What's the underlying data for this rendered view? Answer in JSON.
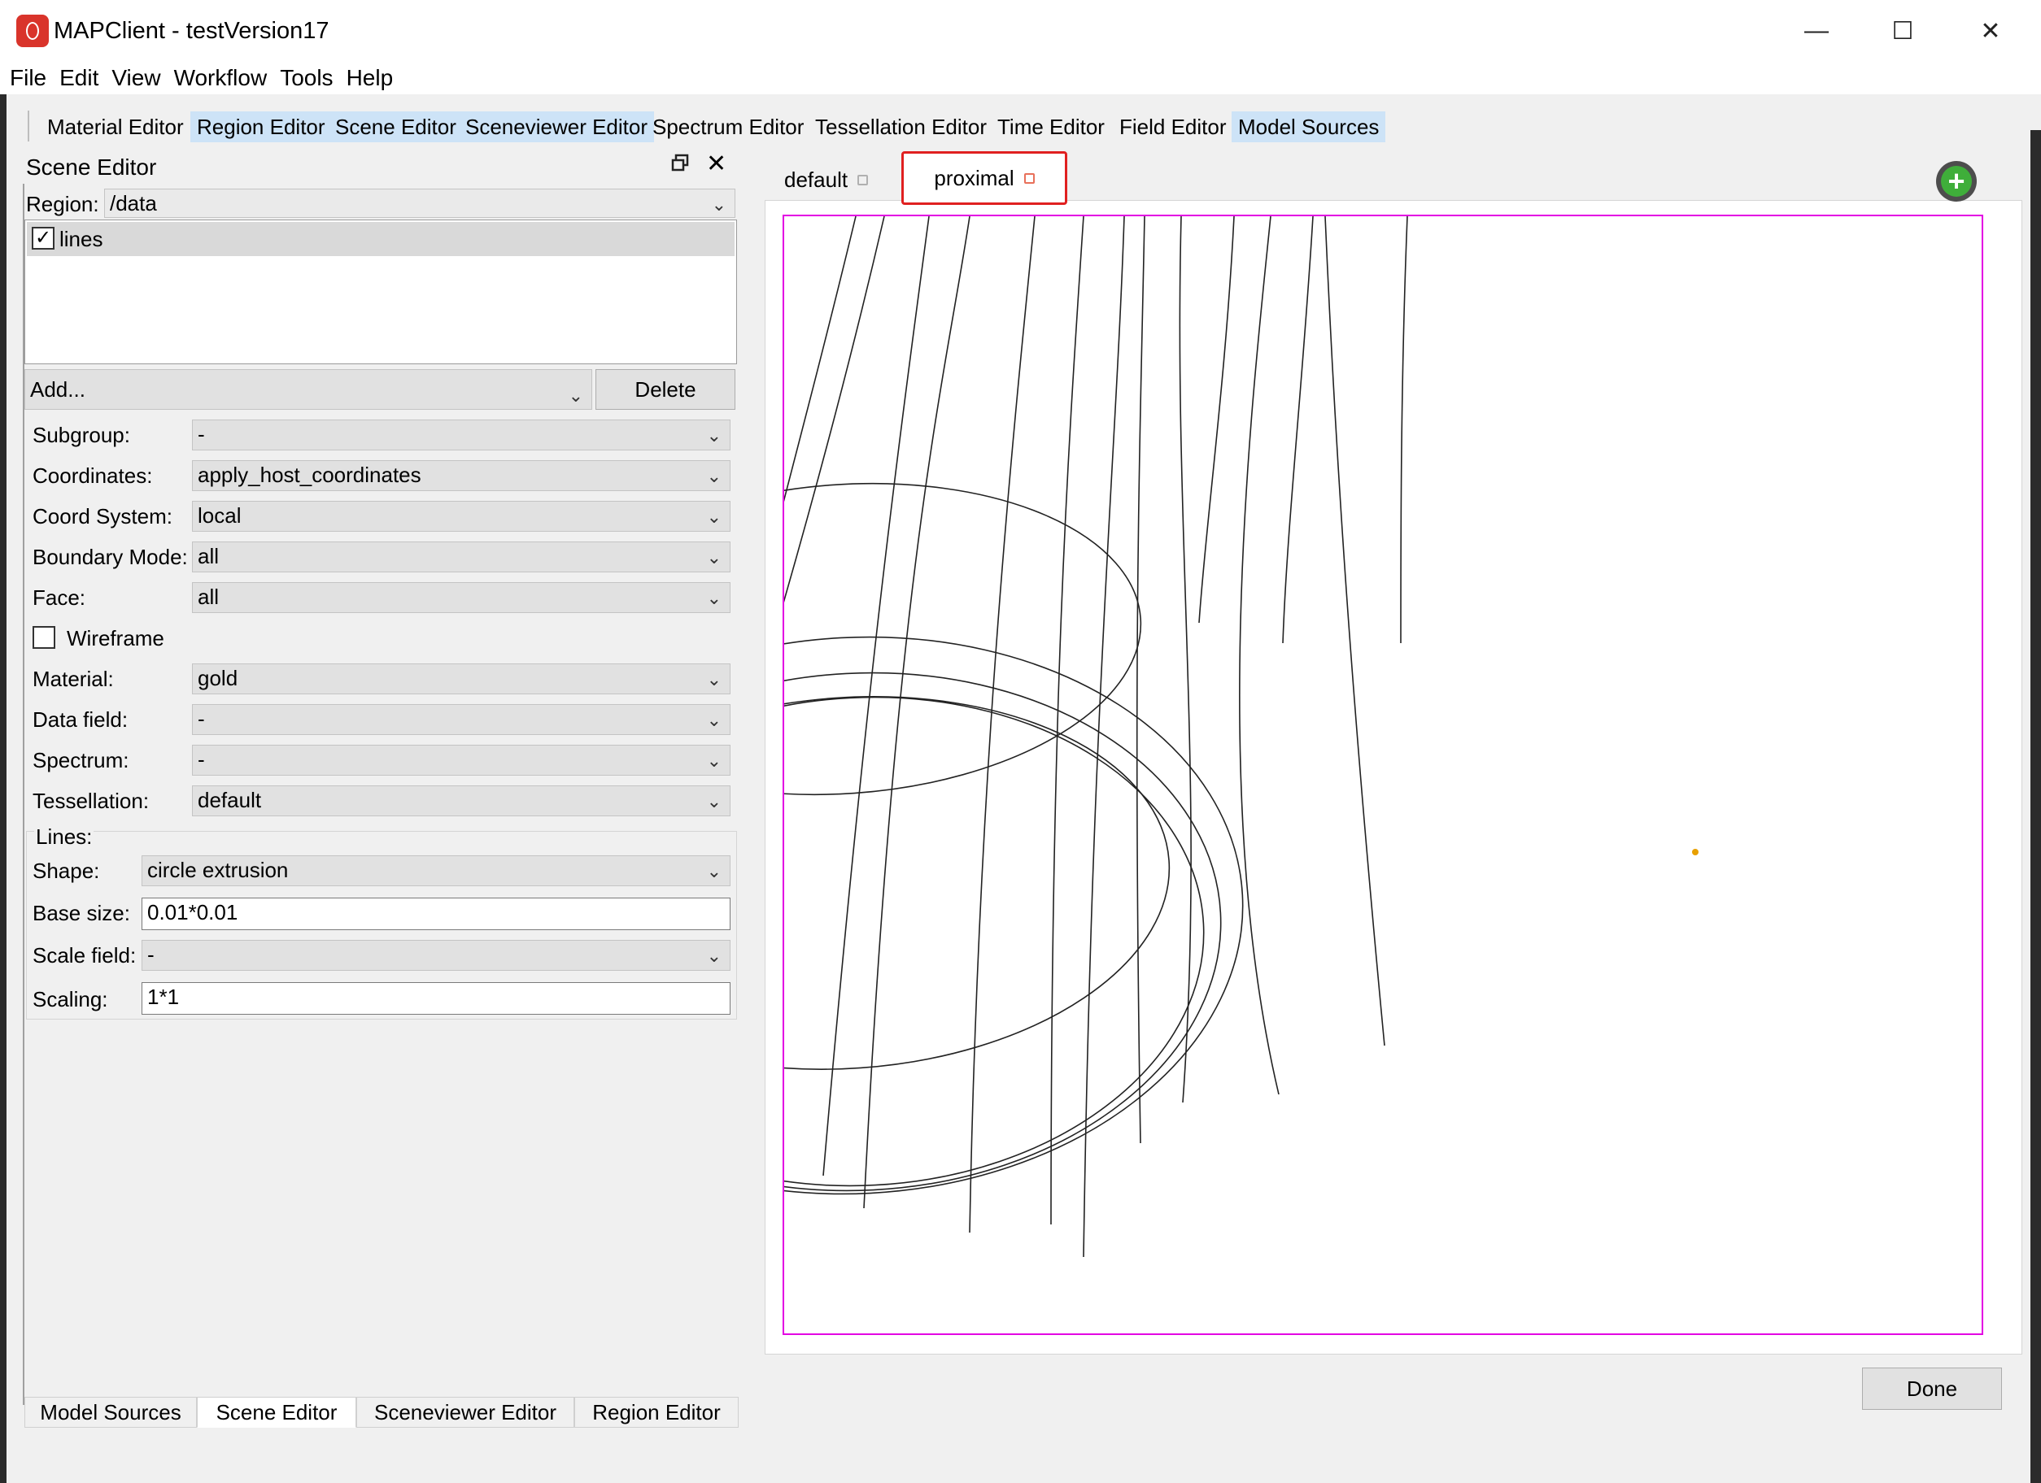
{
  "window": {
    "title": "MAPClient - testVersion17",
    "minimize": "—",
    "maximize": "☐",
    "close": "✕"
  },
  "menu": [
    "File",
    "Edit",
    "View",
    "Workflow",
    "Tools",
    "Help"
  ],
  "editor_tabs": [
    {
      "label": "Material Editor",
      "active": false
    },
    {
      "label": "Region Editor",
      "active": true
    },
    {
      "label": "Scene Editor",
      "active": true
    },
    {
      "label": "Sceneviewer Editor",
      "active": true
    },
    {
      "label": "Spectrum Editor",
      "active": false
    },
    {
      "label": "Tessellation Editor",
      "active": false
    },
    {
      "label": "Time Editor",
      "active": false
    },
    {
      "label": "Field Editor",
      "active": false
    },
    {
      "label": "Model Sources",
      "active": true
    }
  ],
  "scene_editor": {
    "title": "Scene Editor",
    "region_label": "Region:",
    "region_value": "/data",
    "graphics_list": [
      {
        "name": "lines",
        "checked": true
      }
    ],
    "add_placeholder": "Add...",
    "delete_label": "Delete",
    "fields": {
      "subgroup": {
        "label": "Subgroup:",
        "value": "-"
      },
      "coordinates": {
        "label": "Coordinates:",
        "value": "apply_host_coordinates"
      },
      "coord_system": {
        "label": "Coord System:",
        "value": "local"
      },
      "boundary_mode": {
        "label": "Boundary Mode:",
        "value": "all"
      },
      "face": {
        "label": "Face:",
        "value": "all"
      },
      "wireframe": {
        "label": "Wireframe",
        "checked": false
      },
      "material": {
        "label": "Material:",
        "value": "gold"
      },
      "data_field": {
        "label": "Data field:",
        "value": "-"
      },
      "spectrum": {
        "label": "Spectrum:",
        "value": "-"
      },
      "tessellation": {
        "label": "Tessellation:",
        "value": "default"
      }
    },
    "lines": {
      "title": "Lines:",
      "shape": {
        "label": "Shape:",
        "value": "circle extrusion"
      },
      "base_size": {
        "label": "Base size:",
        "value": "0.01*0.01"
      },
      "scale_field": {
        "label": "Scale field:",
        "value": "-"
      },
      "scaling": {
        "label": "Scaling:",
        "value": "1*1"
      }
    }
  },
  "bottom_tabs": [
    {
      "label": "Model Sources",
      "active": false
    },
    {
      "label": "Scene Editor",
      "active": true
    },
    {
      "label": "Sceneviewer Editor",
      "active": false
    },
    {
      "label": "Region Editor",
      "active": false
    }
  ],
  "view_tabs": [
    {
      "label": "default",
      "active": false
    },
    {
      "label": "proximal",
      "active": true
    }
  ],
  "done_label": "Done",
  "colors": {
    "accent_tab": "#cde3f7",
    "viewport_border": "#e300e3",
    "highlight": "#e02020",
    "origin_marker": "#e8a000"
  }
}
